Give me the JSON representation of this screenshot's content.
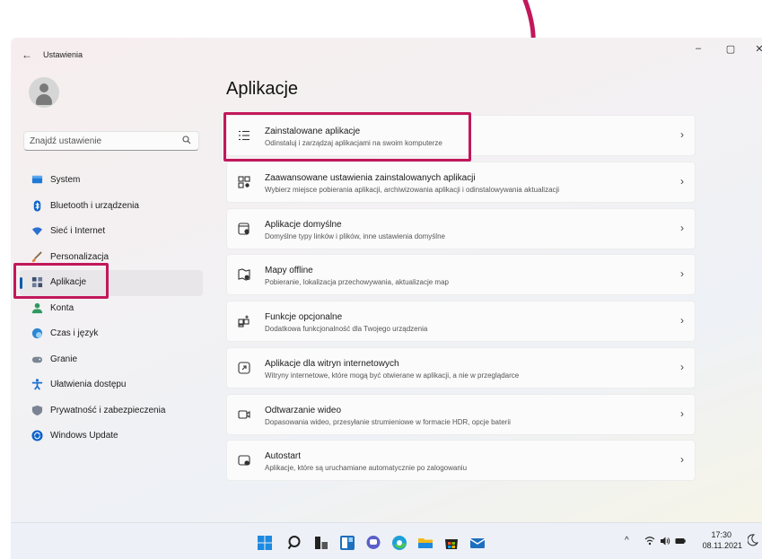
{
  "window": {
    "title": "Ustawienia",
    "back_glyph": "←",
    "minimize_glyph": "–",
    "maximize_glyph": "▢",
    "close_glyph": "✕"
  },
  "search": {
    "placeholder": "Znajdź ustawienie",
    "icon": "search-icon"
  },
  "sidebar": {
    "items": [
      {
        "label": "System",
        "icon": "monitor-icon",
        "color": "#1f7ad6"
      },
      {
        "label": "Bluetooth i urządzenia",
        "icon": "bluetooth-icon",
        "color": "#0e63c8"
      },
      {
        "label": "Sieć i Internet",
        "icon": "wifi-icon",
        "color": "#2b6fd1"
      },
      {
        "label": "Personalizacja",
        "icon": "brush-icon",
        "color": "#e27b35"
      },
      {
        "label": "Aplikacje",
        "icon": "apps-icon",
        "color": "#3d4f6b",
        "active": true
      },
      {
        "label": "Konta",
        "icon": "user-icon",
        "color": "#2e9a5e"
      },
      {
        "label": "Czas i język",
        "icon": "globe-clock-icon",
        "color": "#2c86d4"
      },
      {
        "label": "Granie",
        "icon": "gamepad-icon",
        "color": "#7b8594"
      },
      {
        "label": "Ułatwienia dostępu",
        "icon": "accessibility-icon",
        "color": "#1b6fd1"
      },
      {
        "label": "Prywatność i zabezpieczenia",
        "icon": "shield-icon",
        "color": "#7a8391"
      },
      {
        "label": "Windows Update",
        "icon": "update-icon",
        "color": "#0e63c8"
      }
    ]
  },
  "main": {
    "title": "Aplikacje",
    "cards": [
      {
        "title": "Zainstalowane aplikacje",
        "subtitle": "Odinstaluj i zarządzaj aplikacjami na swoim komputerze",
        "icon": "list-icon"
      },
      {
        "title": "Zaawansowane ustawienia zainstalowanych aplikacji",
        "subtitle": "Wybierz miejsce pobierania aplikacji, archiwizowania aplikacji i odinstalowywania aktualizacji",
        "icon": "apps-settings-icon"
      },
      {
        "title": "Aplikacje domyślne",
        "subtitle": "Domyślne typy linków i plików, inne ustawienia domyślne",
        "icon": "default-apps-icon"
      },
      {
        "title": "Mapy offline",
        "subtitle": "Pobieranie, lokalizacja przechowywania, aktualizacje map",
        "icon": "map-icon"
      },
      {
        "title": "Funkcje opcjonalne",
        "subtitle": "Dodatkowa funkcjonalność dla Twojego urządzenia",
        "icon": "optional-features-icon"
      },
      {
        "title": "Aplikacje dla witryn internetowych",
        "subtitle": "Witryny internetowe, które mogą być otwierane w aplikacji, a nie w przeglądarce",
        "icon": "open-external-icon"
      },
      {
        "title": "Odtwarzanie wideo",
        "subtitle": "Dopasowania wideo, przesyłanie strumieniowe w formacie HDR, opcje baterii",
        "icon": "video-icon"
      },
      {
        "title": "Autostart",
        "subtitle": "Aplikacje, które są uruchamiane automatycznie po zalogowaniu",
        "icon": "startup-icon"
      }
    ],
    "chevron": "›"
  },
  "taskbar": {
    "apps": [
      "start-icon",
      "search-icon",
      "task-view-icon",
      "widgets-icon",
      "chat-icon",
      "edge-icon",
      "file-explorer-icon",
      "store-icon",
      "mail-icon"
    ],
    "tray": {
      "chevron": "^",
      "time": "17:30",
      "date": "08.11.2021"
    }
  },
  "annotation": {
    "color": "#c2185b"
  }
}
